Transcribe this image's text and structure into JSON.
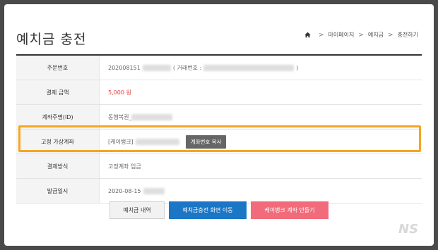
{
  "page": {
    "title": "예치금 충전"
  },
  "breadcrumb": {
    "items": [
      "마이페이지",
      "예치금",
      "충전하기"
    ],
    "separator": ">"
  },
  "table": {
    "rows": [
      {
        "label": "주문번호",
        "value_prefix": "202008151",
        "value_suffix_open": "( 거래번호 :",
        "value_suffix_close": ")"
      },
      {
        "label": "결제 금액",
        "value": "5,000 원"
      },
      {
        "label": "계좌주명(ID)",
        "value": "동행복권_"
      },
      {
        "label": "고정 가상계좌",
        "value": "[케이뱅크]",
        "button": "계좌번호 복사"
      },
      {
        "label": "결제방식",
        "value": "고정계좌 입금"
      },
      {
        "label": "발급일시",
        "value": "2020-08-15"
      }
    ]
  },
  "buttons": {
    "history": "예치금 내역",
    "move": "예치금충전 화면 이동",
    "create": "케이뱅크 계좌 만들기"
  },
  "colors": {
    "highlight": "#f5a623",
    "price": "#e53935",
    "primary": "#1b76c5",
    "pink": "#f26b7a"
  },
  "watermark": "NS"
}
